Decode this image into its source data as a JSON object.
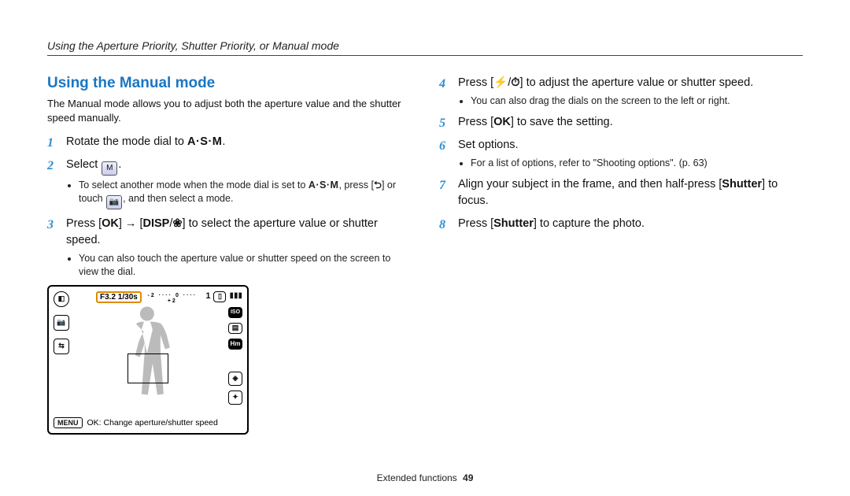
{
  "breadcrumb": "Using the Aperture Priority, Shutter Priority, or Manual mode",
  "section_title": "Using the Manual mode",
  "intro": "The Manual mode allows you to adjust both the aperture value and the shutter speed manually.",
  "left_steps": {
    "s1": {
      "pre": "Rotate the mode dial to ",
      "glyph": "A·S·M",
      "post": "."
    },
    "s2": {
      "pre": "Select ",
      "icon_label": "M",
      "post": ".",
      "sub_a_pre": "To select another mode when the mode dial is set to ",
      "sub_a_glyph": "A·S·M",
      "sub_a_mid": ", press [",
      "sub_a_back": "⮌",
      "sub_a_mid2": "] or touch ",
      "sub_a_touch": "📷",
      "sub_a_end": ", and then select a mode."
    },
    "s3": {
      "pre": "Press [",
      "ok": "OK",
      "mid": "] → [",
      "disp": "DISP",
      "slash": "/",
      "macro": "❀",
      "mid2": "] to select the aperture value or shutter speed.",
      "sub": "You can also touch the aperture value or shutter speed on the screen to view the dial."
    }
  },
  "right_steps": {
    "s4": {
      "pre": "Press [",
      "flash": "⚡",
      "slash": "/",
      "timer": "⏱",
      "post": "] to adjust the aperture value or shutter speed.",
      "sub": "You can also drag the dials on the screen to the left or right."
    },
    "s5": {
      "pre": "Press [",
      "ok": "OK",
      "post": "] to save the setting."
    },
    "s6": {
      "text": "Set options.",
      "sub": "For a list of options, refer to \"Shooting options\". (p. 63)"
    },
    "s7": {
      "pre": "Align your subject in the frame, and then half-press [",
      "shutter": "Shutter",
      "post": "] to focus."
    },
    "s8": {
      "pre": "Press [",
      "shutter": "Shutter",
      "post": "] to capture the photo."
    }
  },
  "camshot": {
    "readout": "F3.2 1/30s",
    "ev_scale": "-2 ···· 0 ···· +2",
    "menu": "MENU",
    "help": "OK: Change aperture/shutter speed",
    "count": "1",
    "batt": "▮▮▮"
  },
  "footer": {
    "label": "Extended functions",
    "page": "49"
  }
}
